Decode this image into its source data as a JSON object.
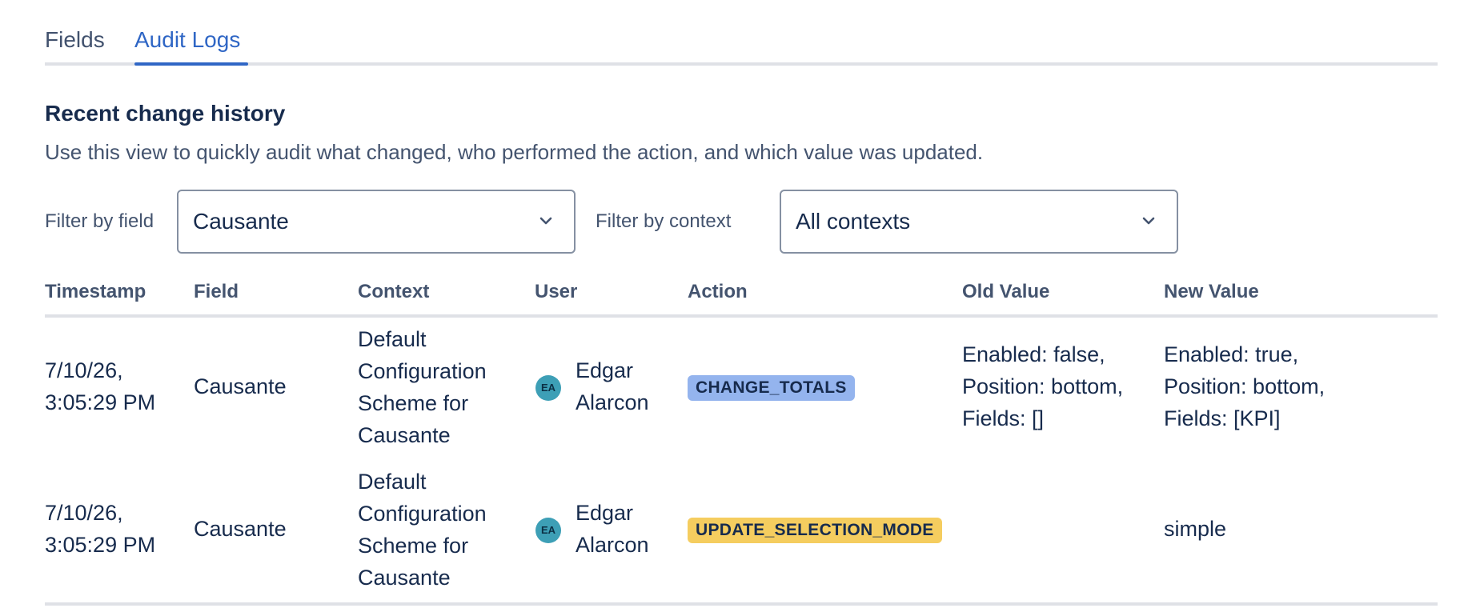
{
  "tabs": [
    {
      "label": "Fields",
      "active": false
    },
    {
      "label": "Audit Logs",
      "active": true
    }
  ],
  "section": {
    "title": "Recent change history",
    "description": "Use this view to quickly audit what changed, who performed the action, and which value was updated."
  },
  "filters": {
    "field_label": "Filter by field",
    "field_value": "Causante",
    "context_label": "Filter by context",
    "context_value": "All contexts"
  },
  "table": {
    "headers": [
      "Timestamp",
      "Field",
      "Context",
      "User",
      "Action",
      "Old Value",
      "New Value"
    ],
    "rows": [
      {
        "timestamp_line1": "7/10/26,",
        "timestamp_line2": "3:05:29 PM",
        "field": "Causante",
        "context_lines": [
          "Default",
          "Configuration",
          "Scheme for",
          "Causante"
        ],
        "user_initials": "EA",
        "user_first": "Edgar",
        "user_last": "Alarcon",
        "action": "CHANGE_TOTALS",
        "action_color": "#94b4ee",
        "old_lines": [
          "Enabled: false,",
          "Position: bottom,",
          "Fields: []"
        ],
        "new_lines": [
          "Enabled: true,",
          "Position: bottom,",
          "Fields: [KPI]"
        ]
      },
      {
        "timestamp_line1": "7/10/26,",
        "timestamp_line2": "3:05:29 PM",
        "field": "Causante",
        "context_lines": [
          "Default",
          "Configuration",
          "Scheme for",
          "Causante"
        ],
        "user_initials": "EA",
        "user_first": "Edgar",
        "user_last": "Alarcon",
        "action": "UPDATE_SELECTION_MODE",
        "action_color": "#f5cd5f",
        "old_lines": [],
        "new_lines": [
          "simple"
        ]
      }
    ]
  },
  "colors": {
    "tab_active": "#2f66c5",
    "divider": "#dfe1e6",
    "avatar": "#3d9fb6"
  },
  "icons": {
    "select_chevron": "chevron-down-icon"
  }
}
